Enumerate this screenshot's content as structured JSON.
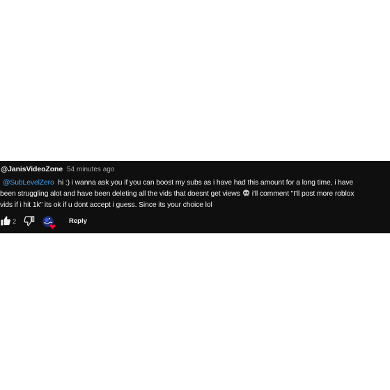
{
  "comment": {
    "author": "@JanisVideoZone",
    "timestamp": "54 minutes ago",
    "mention": "@SubLevelZero",
    "line1_text": "hi :) i wanna ask you if you can boost my subs as i have had this amount for a long time, i have",
    "line2_text_a": "been struggling alot and have been deleting all the vids that doesnt get views",
    "skull_icon": "skull-emoji",
    "line2_text_b": "i'll comment \"I'll post more roblox",
    "line3_text": "vids if i hit 1k\" its ok if u dont accept i guess. Since its your choice lol",
    "like_count": "2",
    "reply_label": "Reply",
    "icons": {
      "like": "thumbs-up-icon",
      "dislike": "thumbs-down-icon",
      "creator_heart": "creator-heart-avatar"
    },
    "colors": {
      "background": "#0f0f0f",
      "text": "#f1f1f1",
      "secondary": "#aaaaaa",
      "mention": "#3ea6ff",
      "heart": "#ff0033"
    }
  }
}
